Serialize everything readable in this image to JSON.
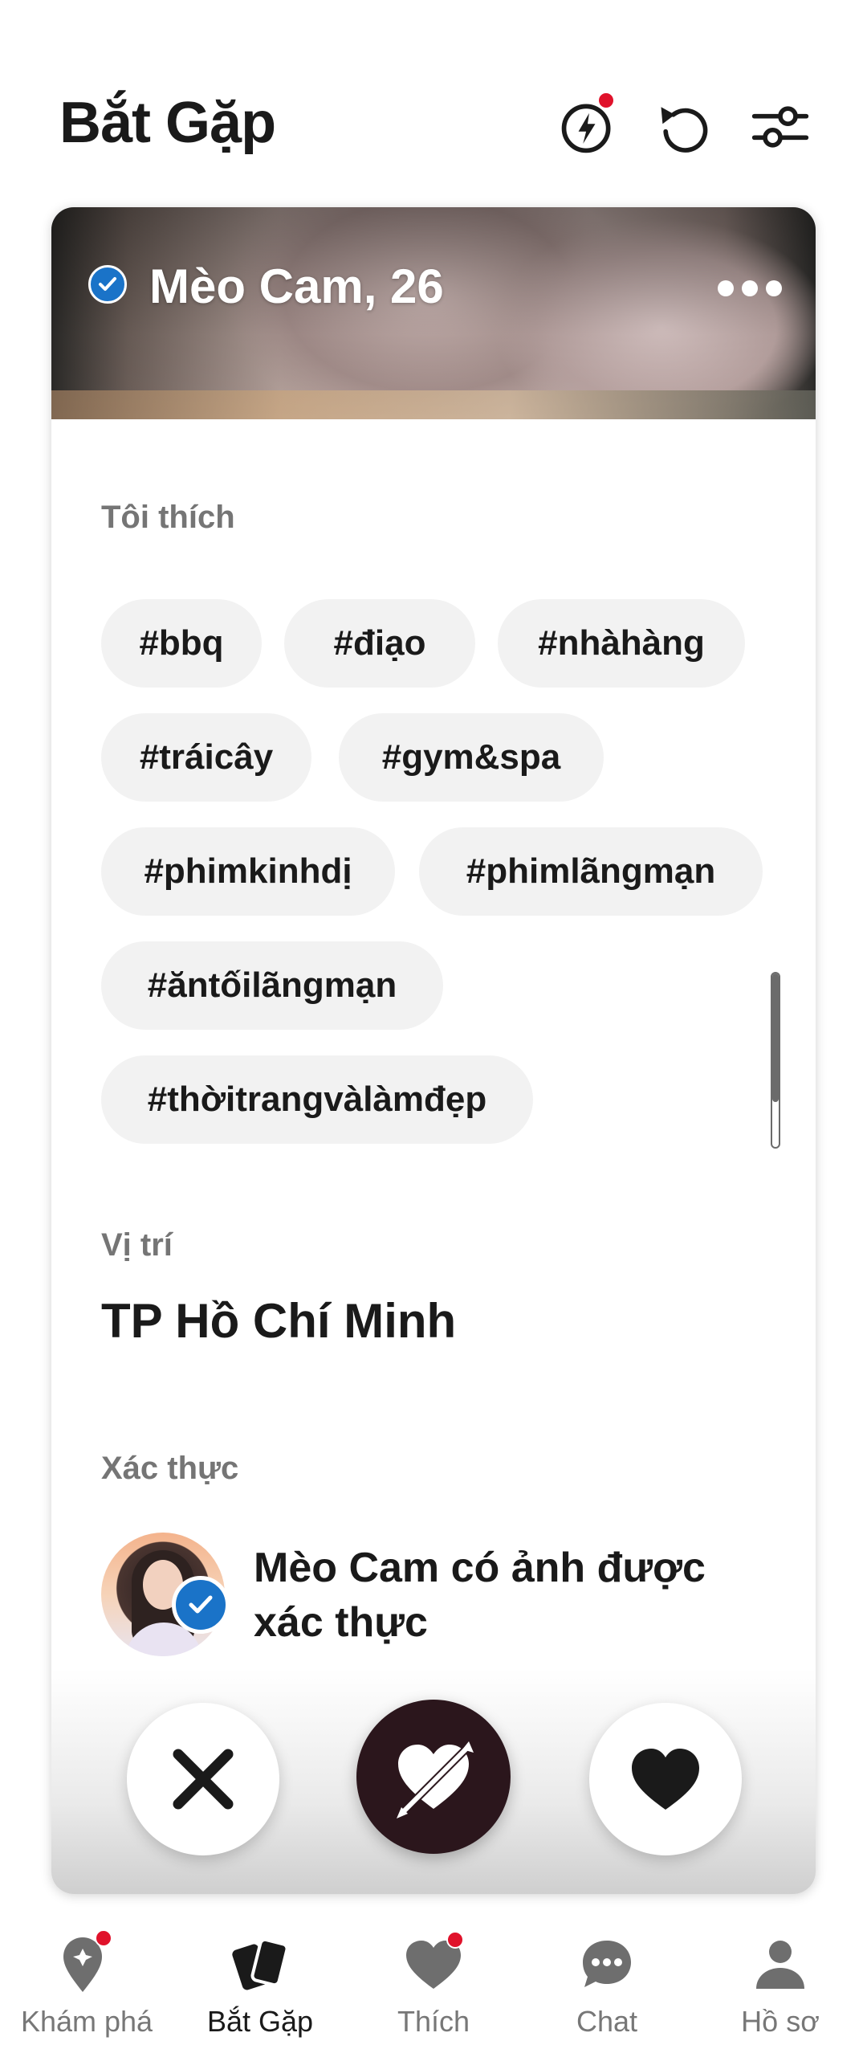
{
  "header": {
    "title": "Bắt Gặp",
    "icons": [
      "boost-icon",
      "undo-icon",
      "filter-icon"
    ]
  },
  "profile": {
    "name": "Mèo Cam, 26",
    "verified": true
  },
  "interests": {
    "label": "Tôi thích",
    "tags": [
      "#bbq",
      "#điạo",
      "#nhàhàng",
      "#tráicây",
      "#gym&spa",
      "#phimkinhdị",
      "#phimlãngmạn",
      "#ăntốilãngmạn",
      "#thờitrangvàlàmđẹp"
    ]
  },
  "location": {
    "label": "Vị trí",
    "value": "TP Hồ Chí Minh"
  },
  "verification": {
    "label": "Xác thực",
    "text": "Mèo Cam có ảnh được xác thực"
  },
  "actions": [
    "nope",
    "super-like",
    "like"
  ],
  "nav": {
    "items": [
      {
        "label": "Khám phá",
        "icon": "explore-pin-icon",
        "badge": true
      },
      {
        "label": "Bắt Gặp",
        "icon": "cards-icon",
        "active": true
      },
      {
        "label": "Thích",
        "icon": "likes-heart-icon",
        "badge": true
      },
      {
        "label": "Chat",
        "icon": "chat-bubble-icon"
      },
      {
        "label": "Hồ sơ",
        "icon": "profile-person-icon"
      }
    ]
  },
  "colors": {
    "accent_red": "#e0122b",
    "verified_blue": "#1a73c8",
    "super_like_bg": "#2b161c"
  }
}
